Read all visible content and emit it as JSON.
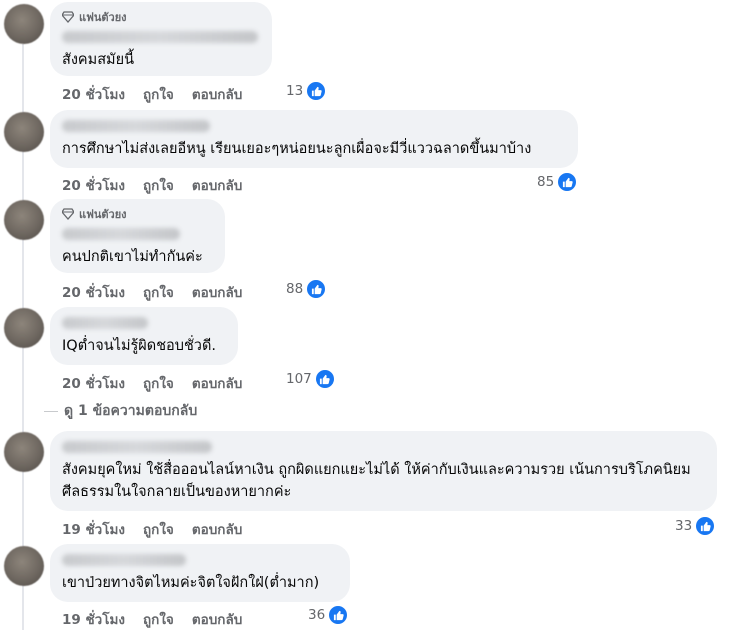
{
  "labels": {
    "like": "ถูกใจ",
    "reply": "ตอบกลับ"
  },
  "comments": [
    {
      "badge": "แฟนตัวยง",
      "text": "สังคมสมัยนี้",
      "time": "20 ชั่วโมง",
      "likes": "13"
    },
    {
      "badge": "",
      "text": "การศึกษาไม่ส่งเลยอีหนู เรียนเยอะๆหน่อยนะลูกเผื่อจะมีวี่แววฉลาดขึ้นมาบ้าง",
      "time": "20 ชั่วโมง",
      "likes": "85"
    },
    {
      "badge": "แฟนตัวยง",
      "text": "คนปกติเขาไม่ทำกันค่ะ",
      "time": "20 ชั่วโมง",
      "likes": "88"
    },
    {
      "badge": "",
      "text": "IQต่ำจนไม่รู้ผิดชอบชั่วดี.",
      "time": "20 ชั่วโมง",
      "likes": "107"
    },
    {
      "badge": "",
      "text": "สังคมยุคใหม่ ใช้สื่อออนไลน์หาเงิน ถูกผิดแยกแยะไม่ได้ ให้ค่ากับเงินและความรวย เน้นการบริโภคนิยม ศีลธรรมในใจกลายเป็นของหายากค่ะ",
      "time": "19 ชั่วโมง",
      "likes": "33"
    },
    {
      "badge": "",
      "text": "เขาป่วยทางจิตไหมค่ะจิตใจฝักใฝ่(ต่ำมาก)",
      "time": "19 ชั่วโมง",
      "likes": "36"
    }
  ],
  "view_replies": "ดู 1 ข้อความตอบกลับ",
  "colors": {
    "bubble": "#f0f2f5",
    "meta": "#65676b",
    "like_blue": "#1877f2"
  },
  "icons": {
    "badge": "diamond-icon",
    "like": "thumbs-up-icon"
  }
}
